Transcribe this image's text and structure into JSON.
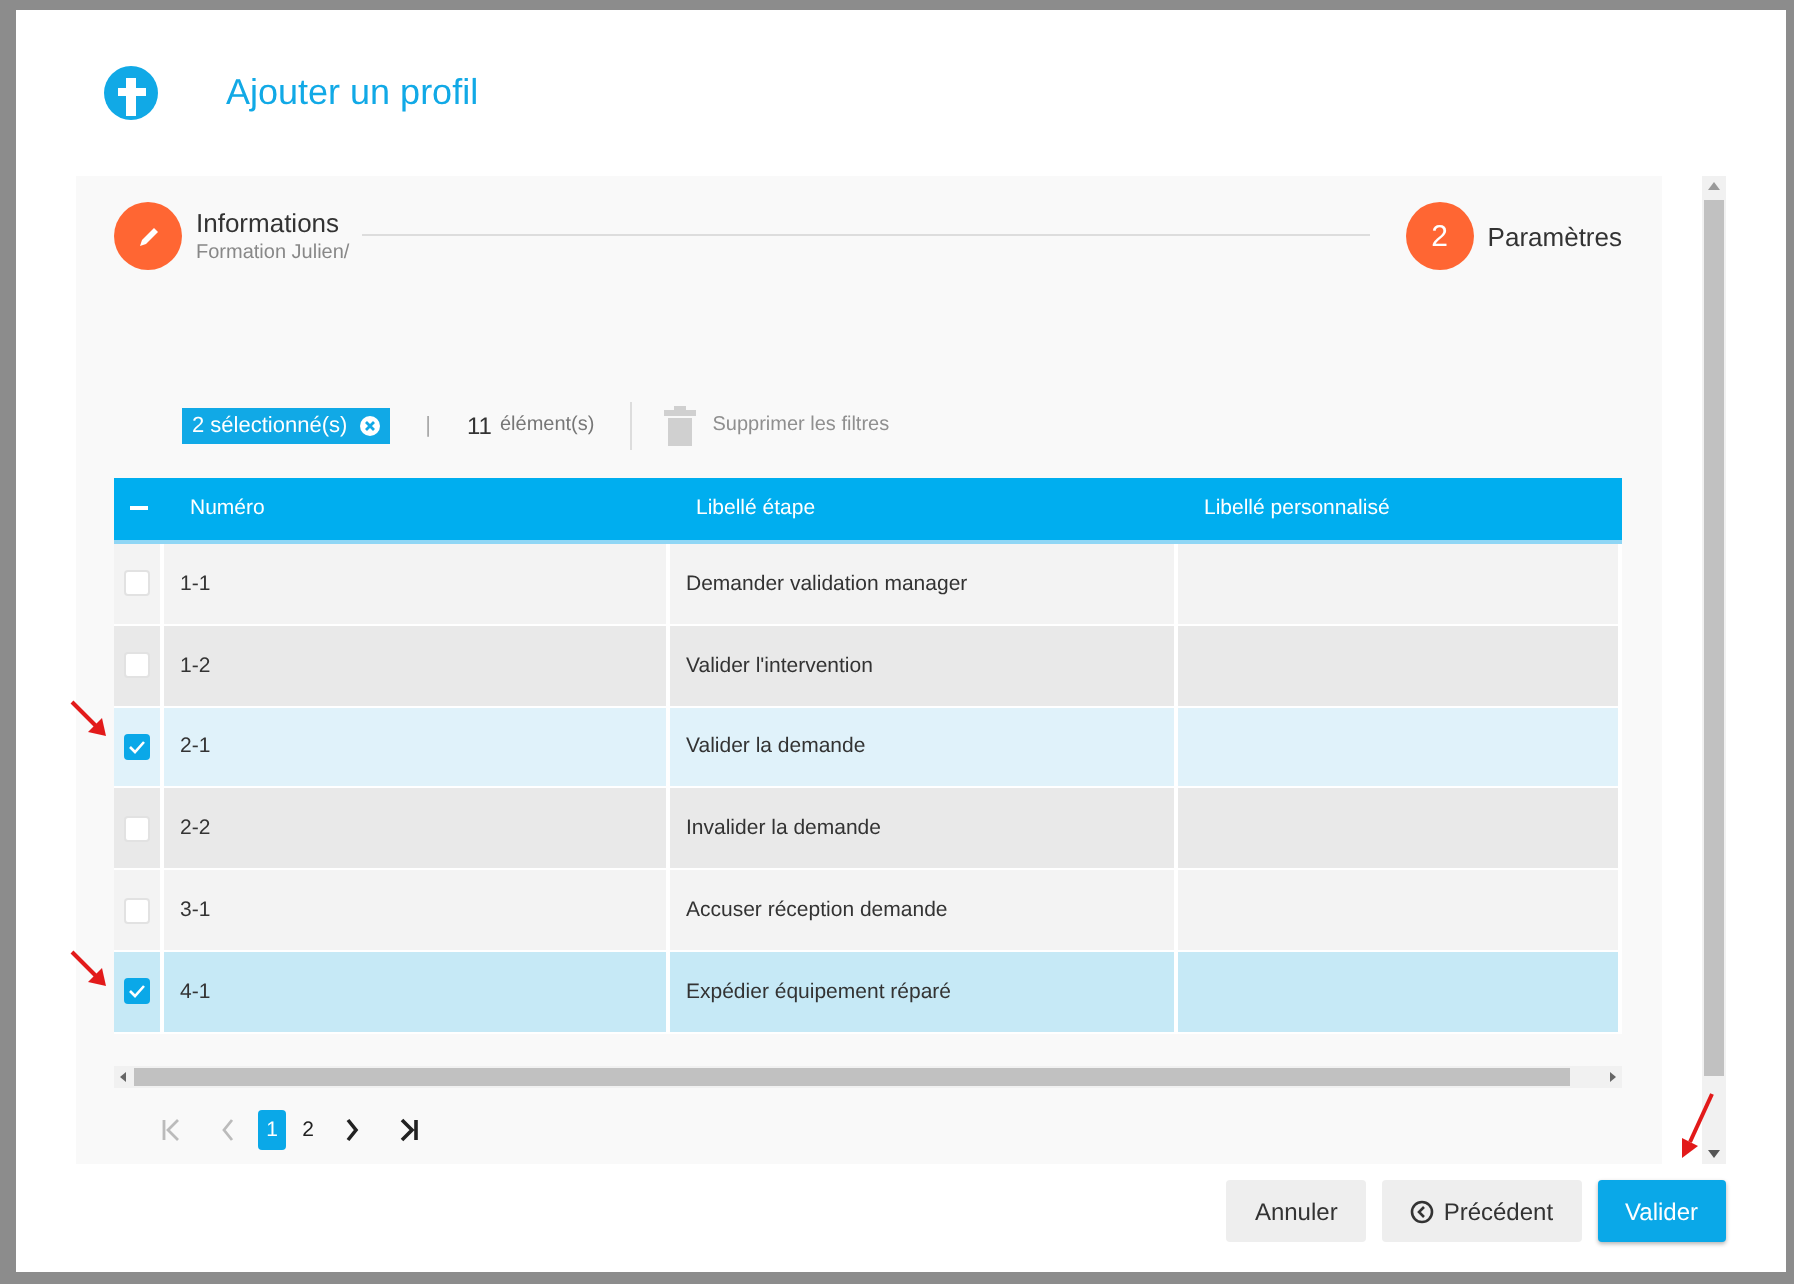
{
  "dialog": {
    "title": "Ajouter un profil"
  },
  "steps": [
    {
      "title": "Informations",
      "subtitle": "Formation Julien/",
      "kind": "done"
    },
    {
      "number": "2",
      "title": "Paramètres",
      "kind": "current"
    }
  ],
  "filters": {
    "selection_badge": "2 sélectionné(s)",
    "separator": "|",
    "count": "11",
    "count_label": "élément(s)",
    "clear_filters": {
      "label": "Supprimer les filtres",
      "disabled": true
    }
  },
  "table": {
    "columns": [
      "Numéro",
      "Libellé étape",
      "Libellé personnalisé"
    ],
    "rows": [
      {
        "cells": [
          "1-1",
          "Demander validation manager",
          ""
        ],
        "selected": false
      },
      {
        "cells": [
          "1-2",
          "Valider l'intervention",
          ""
        ],
        "selected": false
      },
      {
        "cells": [
          "2-1",
          "Valider la demande",
          ""
        ],
        "selected": true
      },
      {
        "cells": [
          "2-2",
          "Invalider la demande",
          ""
        ],
        "selected": false
      },
      {
        "cells": [
          "3-1",
          "Accuser réception demande",
          ""
        ],
        "selected": false
      },
      {
        "cells": [
          "4-1",
          "Expédier équipement réparé",
          ""
        ],
        "selected": true
      }
    ]
  },
  "pagination": {
    "first_disabled": true,
    "prev_disabled": true,
    "pages": [
      {
        "label": "1",
        "selected": true
      },
      {
        "label": "2",
        "selected": false
      }
    ]
  },
  "buttons": [
    {
      "label": "Annuler",
      "kind": "plain"
    },
    {
      "label": "Précédent",
      "kind": "back"
    },
    {
      "label": "Valider",
      "kind": "primary"
    }
  ]
}
